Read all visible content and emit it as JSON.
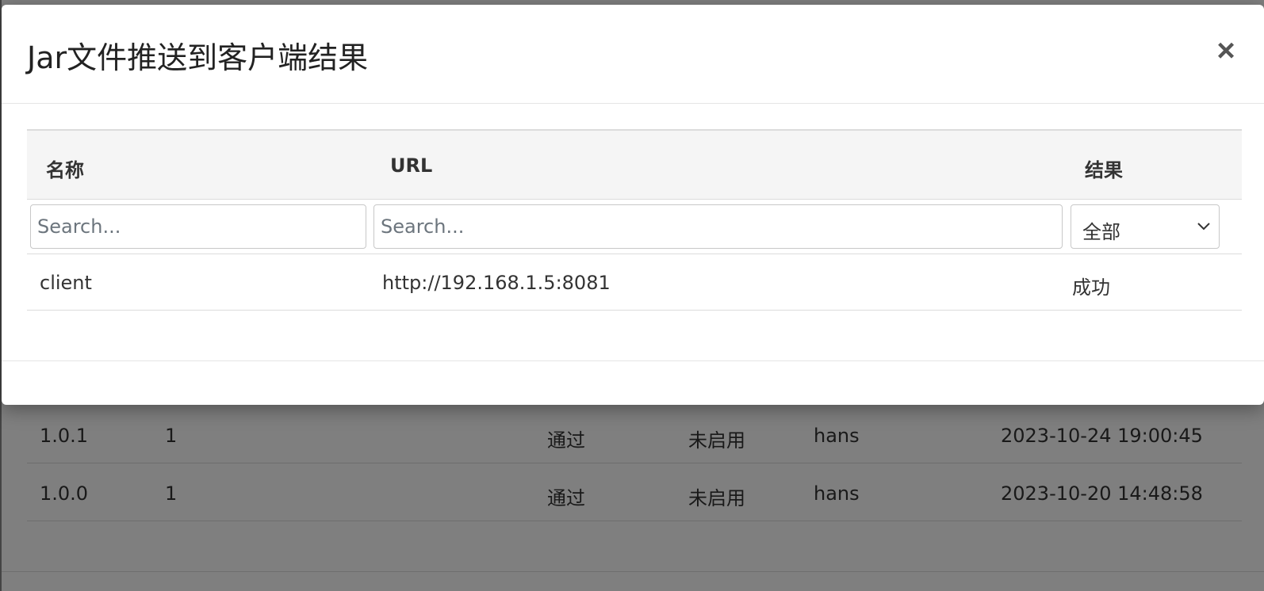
{
  "modal": {
    "title": "Jar文件推送到客户端结果",
    "close_label": "×",
    "table": {
      "headers": [
        "名称",
        "URL",
        "结果"
      ],
      "filters": {
        "name_placeholder": "Search...",
        "url_placeholder": "Search...",
        "result_selected": "全部"
      },
      "rows": [
        {
          "name": "client",
          "url": "http://192.168.1.5:8081",
          "result": "成功"
        }
      ]
    }
  },
  "background_table": {
    "rows": [
      {
        "version": "1.0.1",
        "col2": "1",
        "status": "通过",
        "enabled": "未启用",
        "user": "hans",
        "time": "2023-10-24 19:00:45"
      },
      {
        "version": "1.0.0",
        "col2": "1",
        "status": "通过",
        "enabled": "未启用",
        "user": "hans",
        "time": "2023-10-20 14:48:58"
      }
    ]
  }
}
